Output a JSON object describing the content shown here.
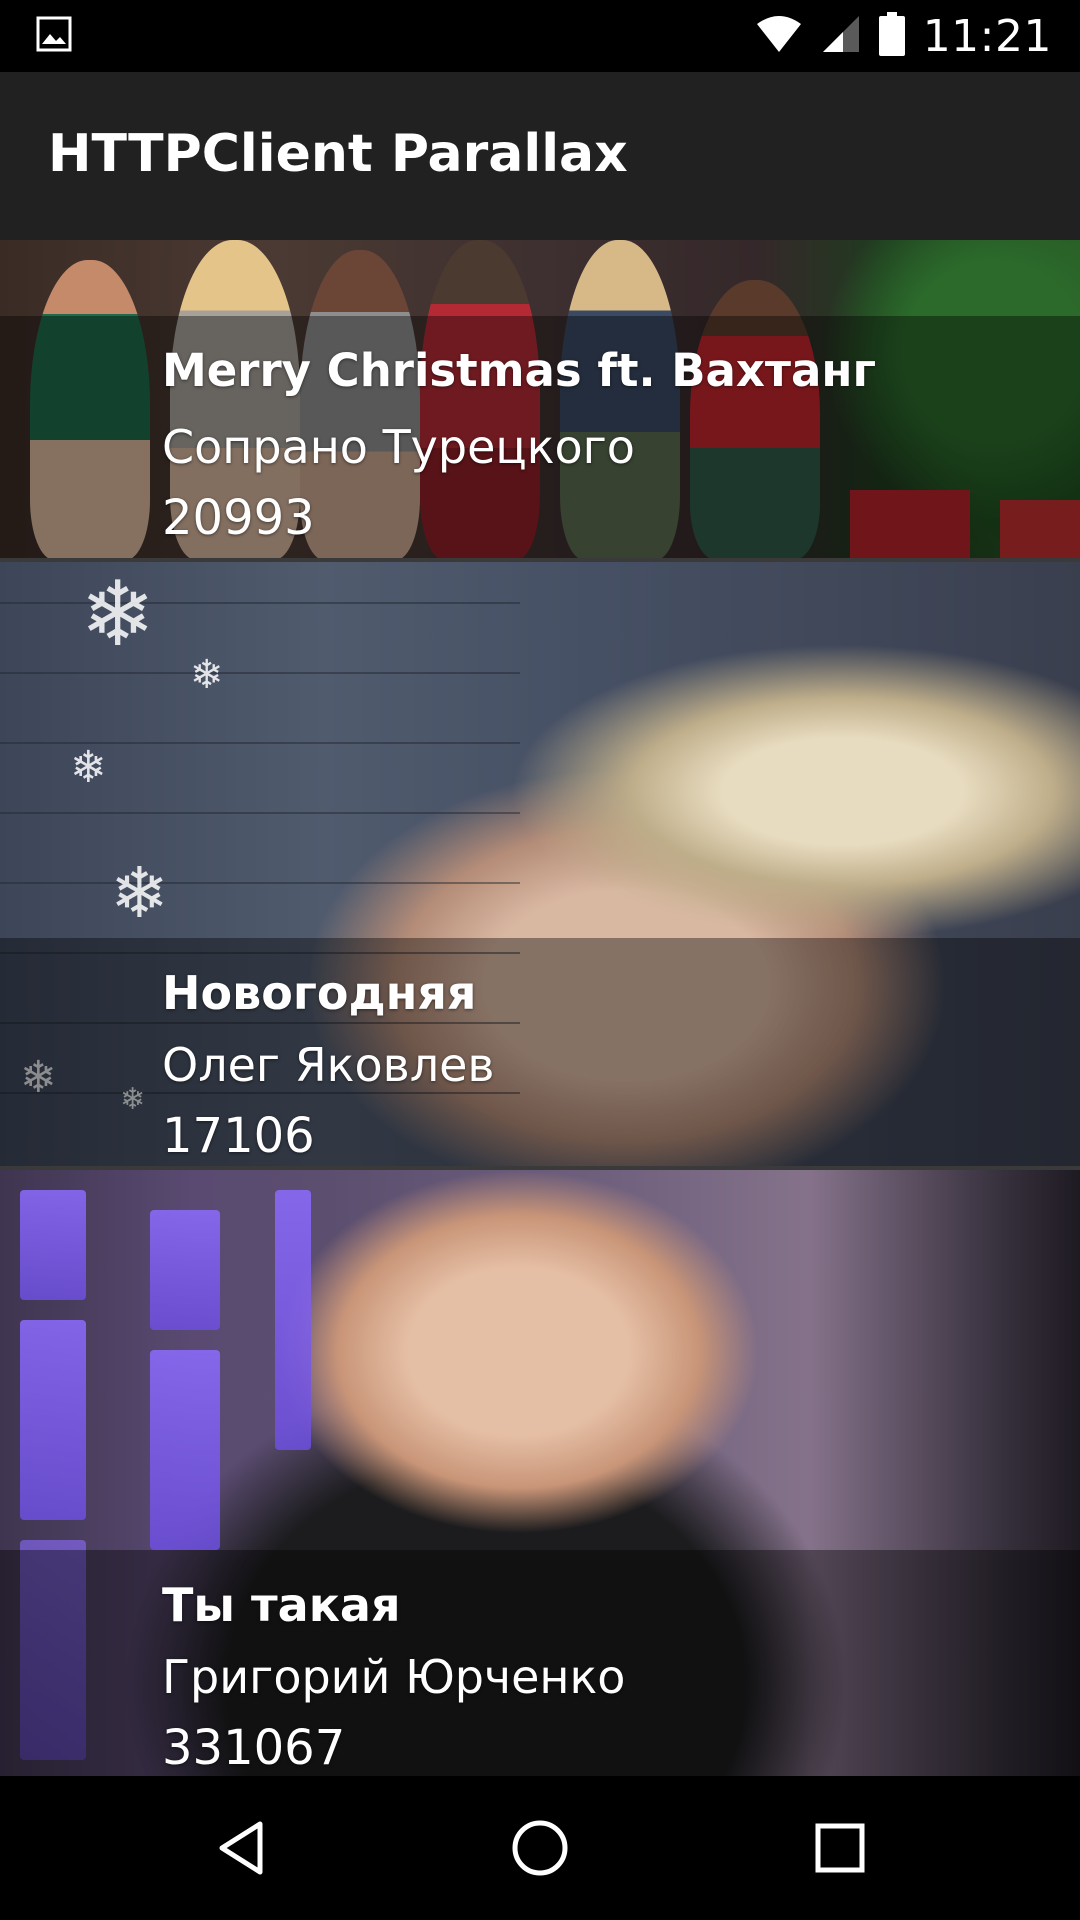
{
  "status_bar": {
    "time": "11:21",
    "left_icon": "image-notification-icon",
    "icons": [
      "wifi-icon",
      "cell-signal-icon",
      "battery-icon"
    ]
  },
  "app_bar": {
    "title": "HTTPClient Parallax"
  },
  "songs": [
    {
      "title": "Merry Christmas ft. Вахтанг",
      "artist": "Сопрано Турецкого",
      "count": "20993"
    },
    {
      "title": "Новогодняя",
      "artist": "Олег Яковлев",
      "count": "17106"
    },
    {
      "title": "Ты такая",
      "artist": "Григорий Юрченко",
      "count": "331067"
    }
  ],
  "nav_bar": {
    "icons": [
      "back-icon",
      "home-icon",
      "recents-icon"
    ]
  },
  "colors": {
    "status_bar": "#000000",
    "app_bar": "#212121",
    "nav_bar": "#000000",
    "text": "#ffffff"
  }
}
